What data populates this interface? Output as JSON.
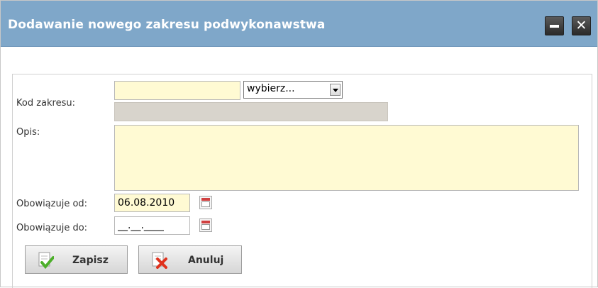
{
  "dialog": {
    "title": "Dodawanie nowego zakresu podwykonawstwa",
    "minimize_icon": "minimize-icon",
    "close_icon": "close-icon"
  },
  "form": {
    "kod_label": "Kod zakresu:",
    "kod_value": "",
    "kod_select_value": "wybierz...",
    "kod_desc_value": "",
    "opis_label": "Opis:",
    "opis_value": "",
    "od_label": "Obowiązuje od:",
    "od_value": "06.08.2010",
    "do_label": "Obowiązuje do:",
    "do_value": "__.__.____",
    "calendar_icon": "calendar-icon"
  },
  "buttons": {
    "save_label": "Zapisz",
    "cancel_label": "Anuluj",
    "save_icon": "document-check-icon",
    "cancel_icon": "document-cross-icon"
  },
  "colors": {
    "titlebar": "#7fa7c9",
    "input_yellow": "#fffad3",
    "input_grey": "#d8d4cc"
  }
}
